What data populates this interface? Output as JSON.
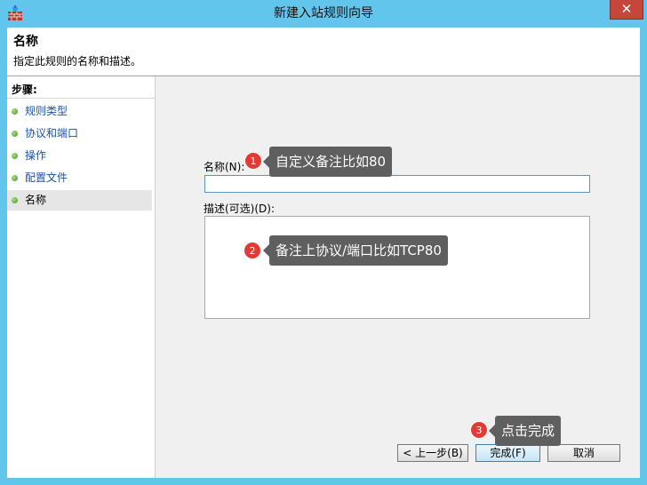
{
  "window": {
    "title": "新建入站规则向导",
    "close_label": "✕"
  },
  "header": {
    "title": "名称",
    "subtitle": "指定此规则的名称和描述。"
  },
  "steps": {
    "heading": "步骤:",
    "items": [
      {
        "label": "规则类型"
      },
      {
        "label": "协议和端口"
      },
      {
        "label": "操作"
      },
      {
        "label": "配置文件"
      },
      {
        "label": "名称"
      }
    ]
  },
  "form": {
    "name_label": "名称(N):",
    "name_value": "",
    "desc_label": "描述(可选)(D):",
    "desc_value": ""
  },
  "buttons": {
    "back": "< 上一步(B)",
    "finish": "完成(F)",
    "cancel": "取消"
  },
  "annotations": [
    {
      "number": "1",
      "text": "自定义备注比如80"
    },
    {
      "number": "2",
      "text": "备注上协议/端口比如TCP80"
    },
    {
      "number": "3",
      "text": "点击完成"
    }
  ]
}
